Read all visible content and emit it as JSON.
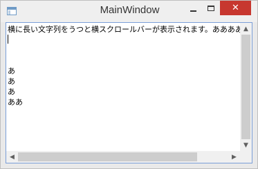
{
  "window": {
    "title": "MainWindow",
    "controls": {
      "minimize": "–",
      "maximize": "□",
      "close": "✕"
    },
    "close_color": "#c7372f"
  },
  "textbox": {
    "lines": [
      "横に長い文字列をうつと横スクロールバーが表示されます。ああああああ",
      "",
      "",
      "",
      "あ",
      "あ",
      "あ",
      "ああ"
    ],
    "border_color": "#7a9ed8"
  },
  "scrollbars": {
    "vertical": {
      "up_arrow": "▲",
      "down_arrow": "▼",
      "thumb_fraction": 1.0
    },
    "horizontal": {
      "left_arrow": "◀",
      "right_arrow": "▶",
      "thumb_fraction": 0.85
    }
  }
}
